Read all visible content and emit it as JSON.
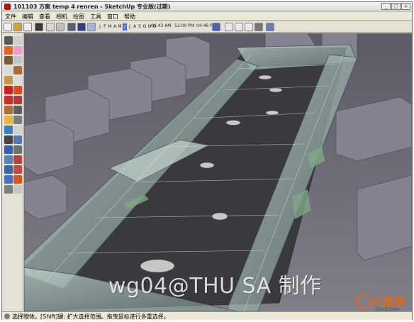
{
  "window": {
    "title": "101103 方案 temp 4 renren - SketchUp 专业版(过期)",
    "buttons": [
      "_",
      "□",
      "×"
    ]
  },
  "menu": [
    "文件",
    "编辑",
    "查看",
    "相机",
    "绘图",
    "工具",
    "窗口",
    "帮助"
  ],
  "toolbar": {
    "months": [
      "J",
      "F",
      "M",
      "A",
      "M",
      "J",
      "J",
      "A",
      "S",
      "O",
      "N",
      "D"
    ],
    "active_month_index": 5,
    "time_start": "06:43 AM",
    "time_noon": "12:00 PM",
    "time_end": "04:46 PM"
  },
  "icons": {
    "left_toolbar": [
      "select-icon",
      "make-component-icon",
      "paint-bucket-icon",
      "eraser-icon",
      "rectangle-icon",
      "line-icon",
      "circle-icon",
      "arc-icon",
      "polygon-icon",
      "freehand-icon",
      "move-icon",
      "push-pull-icon",
      "rotate-icon",
      "follow-me-icon",
      "scale-icon",
      "offset-icon",
      "tape-measure-icon",
      "dimension-icon",
      "protractor-icon",
      "text-icon",
      "axes-icon",
      "3d-text-icon",
      "orbit-icon",
      "pan-icon",
      "zoom-icon",
      "zoom-window-icon",
      "zoom-extents-icon",
      "previous-icon",
      "position-camera-icon",
      "walk-icon",
      "look-around-icon",
      "section-plane-icon"
    ]
  },
  "watermark": "wg04@THU SA 制作",
  "logo": {
    "text": "火星网",
    "sub": "hxsd.com"
  },
  "statusbar": {
    "text": "选择物体。[Shift]键: 扩大选择范围。拖曳鼠标进行多重选择。"
  }
}
